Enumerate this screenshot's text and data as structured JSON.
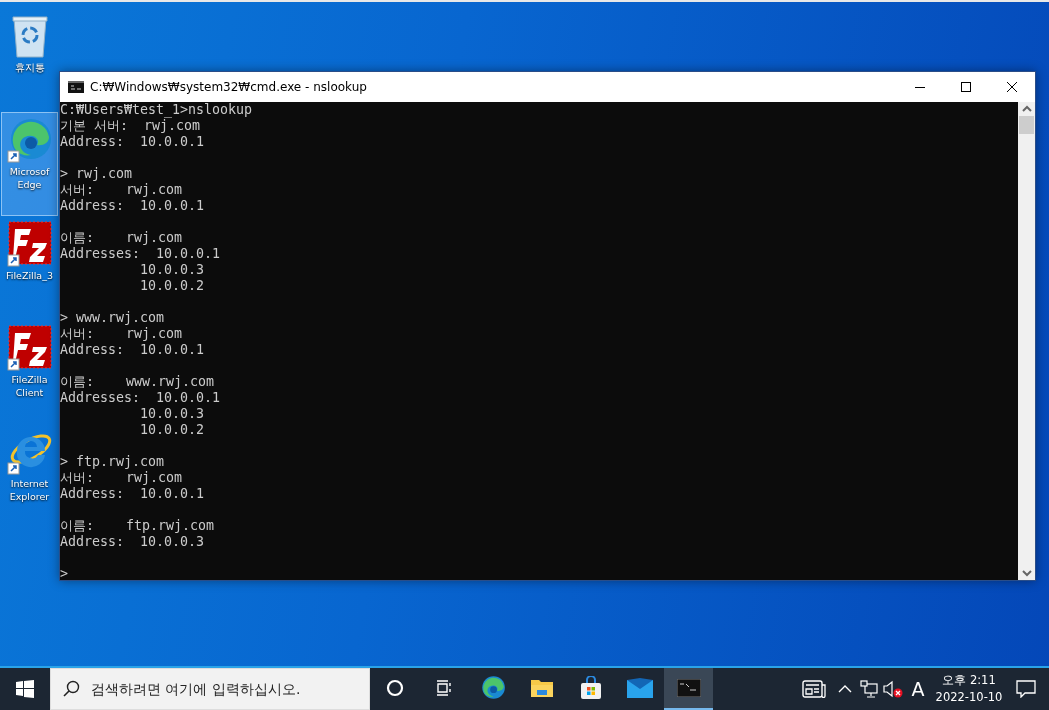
{
  "desktop_icons": [
    {
      "kind": "recycle-bin",
      "label": [
        "휴지통"
      ],
      "selected": false
    },
    {
      "kind": "edge",
      "label": [
        "Microsof",
        "Edge"
      ],
      "selected": true
    },
    {
      "kind": "filezilla",
      "label": [
        "FileZilla_3"
      ],
      "selected": false
    },
    {
      "kind": "filezilla",
      "label": [
        "FileZilla",
        "Client"
      ],
      "selected": false
    },
    {
      "kind": "ie",
      "label": [
        "Internet",
        "Explorer"
      ],
      "selected": false
    }
  ],
  "window": {
    "title": "C:₩Windows₩system32₩cmd.exe - nslookup",
    "console_blocks": [
      [
        "C:₩Users₩test_1>nslookup",
        "기본 서버:  rwj.com",
        "Address:  10.0.0.1"
      ],
      [
        "> rwj.com",
        "서버:    rwj.com",
        "Address:  10.0.0.1"
      ],
      [
        "이름:    rwj.com",
        "Addresses:  10.0.0.1",
        "          10.0.0.3",
        "          10.0.0.2"
      ],
      [
        "> www.rwj.com",
        "서버:    rwj.com",
        "Address:  10.0.0.1"
      ],
      [
        "이름:    www.rwj.com",
        "Addresses:  10.0.0.1",
        "          10.0.0.3",
        "          10.0.0.2"
      ],
      [
        "> ftp.rwj.com",
        "서버:    rwj.com",
        "Address:  10.0.0.1"
      ],
      [
        "이름:    ftp.rwj.com",
        "Address:  10.0.0.3"
      ],
      [
        ">"
      ]
    ]
  },
  "taskbar": {
    "search": {
      "placeholder": "검색하려면 여기에 입력하십시오."
    },
    "apps": [
      {
        "kind": "cortana",
        "selected": false
      },
      {
        "kind": "taskview",
        "selected": false
      },
      {
        "kind": "edge",
        "selected": false
      },
      {
        "kind": "explorer",
        "selected": false
      },
      {
        "kind": "store",
        "selected": false
      },
      {
        "kind": "mail",
        "selected": false
      },
      {
        "kind": "cmd",
        "selected": true
      }
    ],
    "ime": "A",
    "time": "오후 2:11",
    "date": "2022-10-10"
  }
}
